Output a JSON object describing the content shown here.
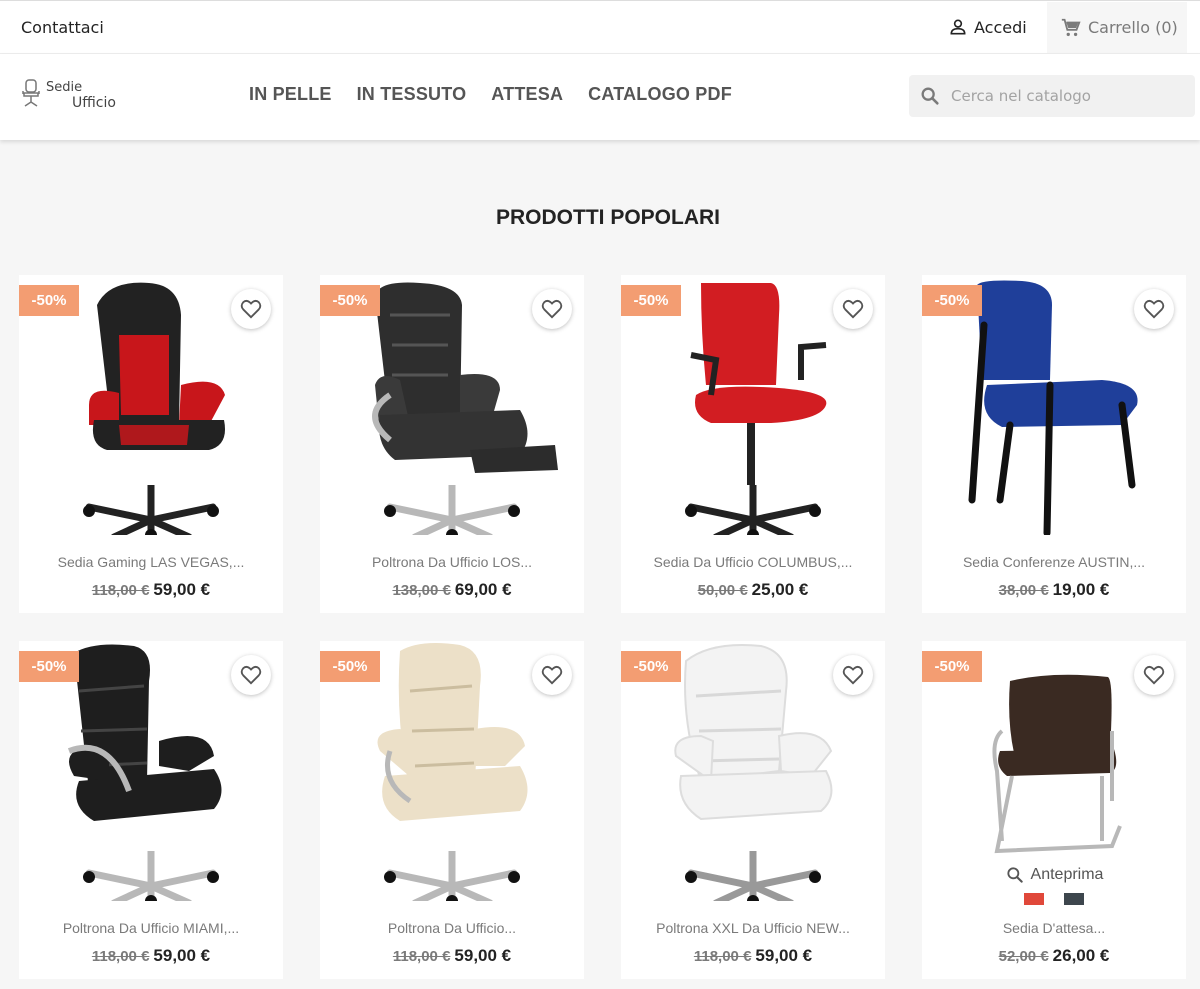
{
  "topbar": {
    "contact": "Contattaci",
    "login": "Accedi",
    "cart": "Carrello (0)"
  },
  "header": {
    "logo_line1": "Sedie",
    "logo_line2": "Ufficio",
    "nav": [
      "IN PELLE",
      "IN TESSUTO",
      "ATTESA",
      "CATALOGO PDF"
    ],
    "search_placeholder": "Cerca nel catalogo"
  },
  "section_title": "PRODOTTI POPOLARI",
  "products": [
    {
      "name": "Sedia Gaming LAS VEGAS,...",
      "old_price": "118,00 €",
      "price": "59,00 €",
      "discount": "-50%",
      "color": "#c8161b"
    },
    {
      "name": "Poltrona Da Ufficio LOS...",
      "old_price": "138,00 €",
      "price": "69,00 €",
      "discount": "-50%",
      "color": "#2e2e2e"
    },
    {
      "name": "Sedia Da Ufficio COLUMBUS,...",
      "old_price": "50,00 €",
      "price": "25,00 €",
      "discount": "-50%",
      "color": "#d21d22"
    },
    {
      "name": "Sedia Conferenze AUSTIN,...",
      "old_price": "38,00 €",
      "price": "19,00 €",
      "discount": "-50%",
      "color": "#1f3f9a"
    },
    {
      "name": "Poltrona Da Ufficio MIAMI,...",
      "old_price": "118,00 €",
      "price": "59,00 €",
      "discount": "-50%",
      "color": "#1e1e1e"
    },
    {
      "name": "Poltrona Da Ufficio...",
      "old_price": "118,00 €",
      "price": "59,00 €",
      "discount": "-50%",
      "color": "#ece0c8"
    },
    {
      "name": "Poltrona XXL Da Ufficio NEW...",
      "old_price": "118,00 €",
      "price": "59,00 €",
      "discount": "-50%",
      "color": "#f3f3f3"
    },
    {
      "name": "Sedia D'attesa...",
      "old_price": "52,00 €",
      "price": "26,00 €",
      "discount": "-50%",
      "color": "#3a2a22",
      "quick_view": "Anteprima",
      "swatches": [
        "#e0483a",
        "#3d464d"
      ]
    }
  ]
}
